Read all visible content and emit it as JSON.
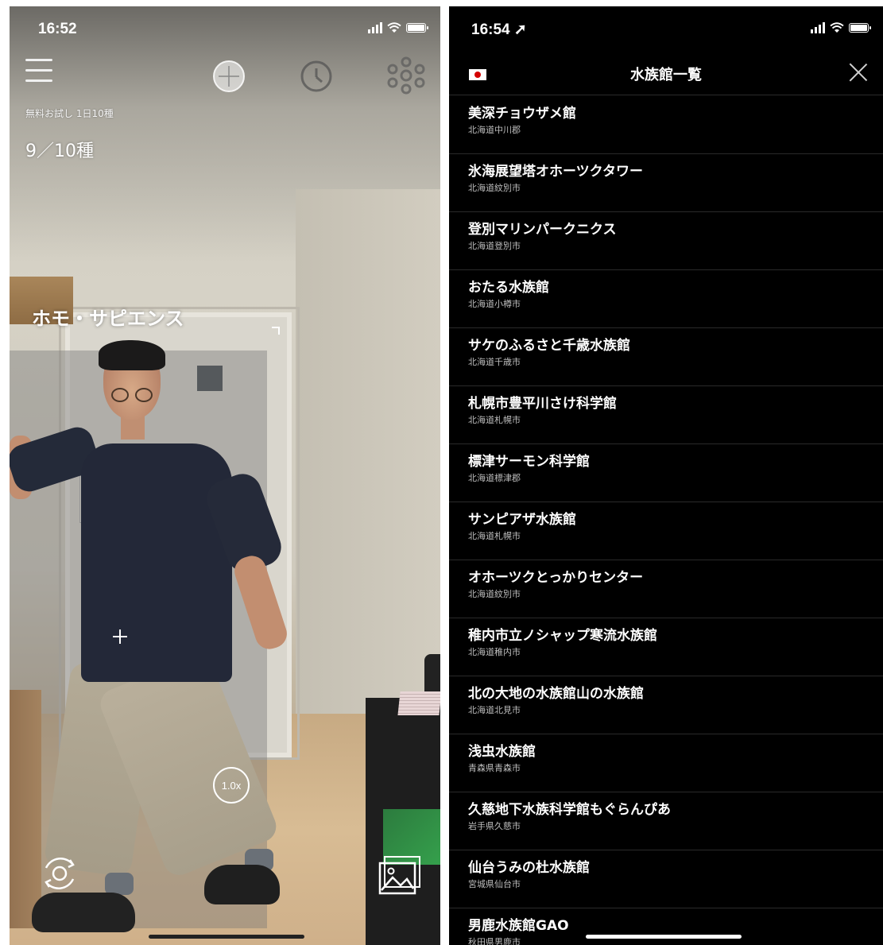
{
  "camera_screen": {
    "status_time": "16:52",
    "trial_label": "無料お試し 1日10種",
    "count_label": "9／10種",
    "detected_species": "ホモ・サピエンス",
    "zoom_label": "1.0x",
    "icons": {
      "menu": "hamburger-menu-icon",
      "locate": "crosshair-icon",
      "history": "clock-icon",
      "share": "network-icon",
      "flip": "camera-flip-icon",
      "gallery": "photo-gallery-icon"
    }
  },
  "aquarium_screen": {
    "status_time": "16:54 ➚",
    "title": "水族館一覧",
    "country_flag": "japan-flag-icon",
    "items": [
      {
        "name": "美深チョウザメ館",
        "location": "北海道中川郡"
      },
      {
        "name": "氷海展望塔オホーツクタワー",
        "location": "北海道紋別市"
      },
      {
        "name": "登別マリンパークニクス",
        "location": "北海道登別市"
      },
      {
        "name": "おたる水族館",
        "location": "北海道小樽市"
      },
      {
        "name": "サケのふるさと千歳水族館",
        "location": "北海道千歳市"
      },
      {
        "name": "札幌市豊平川さけ科学館",
        "location": "北海道札幌市"
      },
      {
        "name": "標津サーモン科学館",
        "location": "北海道標津郡"
      },
      {
        "name": "サンピアザ水族館",
        "location": "北海道札幌市"
      },
      {
        "name": "オホーツクとっかりセンター",
        "location": "北海道紋別市"
      },
      {
        "name": "稚内市立ノシャップ寒流水族館",
        "location": "北海道稚内市"
      },
      {
        "name": "北の大地の水族館山の水族館",
        "location": "北海道北見市"
      },
      {
        "name": "浅虫水族館",
        "location": "青森県青森市"
      },
      {
        "name": "久慈地下水族科学館もぐらんぴあ",
        "location": "岩手県久慈市"
      },
      {
        "name": "仙台うみの杜水族館",
        "location": "宮城県仙台市"
      },
      {
        "name": "男鹿水族館GAO",
        "location": "秋田県男鹿市"
      }
    ]
  }
}
